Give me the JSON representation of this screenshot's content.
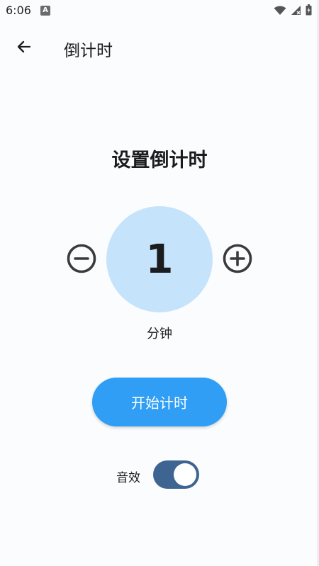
{
  "status_bar": {
    "time": "6:06",
    "app_icon_letter": "A",
    "icons": [
      "wifi-icon",
      "signal-icon",
      "battery-icon"
    ]
  },
  "app_bar": {
    "title": "倒计时",
    "back_icon": "arrow-left-icon"
  },
  "main": {
    "section_title": "设置倒计时",
    "value": "1",
    "unit": "分钟",
    "decrement_icon": "minus-circle-icon",
    "increment_icon": "plus-circle-icon",
    "start_button_label": "开始计时",
    "sound_label": "音效",
    "sound_enabled": true
  },
  "colors": {
    "background": "#fbfcfe",
    "circle": "#c5e3fb",
    "start_button": "#2f9ef4",
    "switch_track": "#3e6591"
  }
}
